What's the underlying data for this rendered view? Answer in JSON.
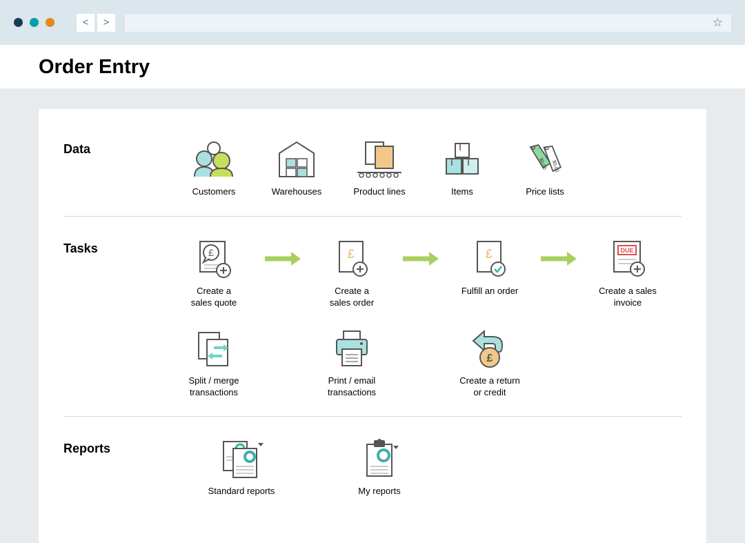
{
  "page_title": "Order Entry",
  "sections": {
    "data": {
      "label": "Data",
      "items": [
        {
          "label": "Customers"
        },
        {
          "label": "Warehouses"
        },
        {
          "label": "Product lines"
        },
        {
          "label": "Items"
        },
        {
          "label": "Price lists"
        }
      ]
    },
    "tasks": {
      "label": "Tasks",
      "row1": [
        {
          "label": "Create a\nsales quote"
        },
        {
          "label": "Create a\nsales order"
        },
        {
          "label": "Fulfill an order"
        },
        {
          "label": "Create a sales\ninvoice"
        }
      ],
      "row2": [
        {
          "label": "Split / merge\ntransactions"
        },
        {
          "label": "Print / email\ntransactions"
        },
        {
          "label": "Create a return\nor credit"
        }
      ]
    },
    "reports": {
      "label": "Reports",
      "items": [
        {
          "label": "Standard reports"
        },
        {
          "label": "My reports"
        }
      ]
    }
  },
  "colors": {
    "accent_green": "#a9d05c",
    "light_teal": "#a9e1e0",
    "orange_fill": "#f2c889",
    "red": "#d94f4f",
    "soft_green": "#8fd8a0"
  }
}
